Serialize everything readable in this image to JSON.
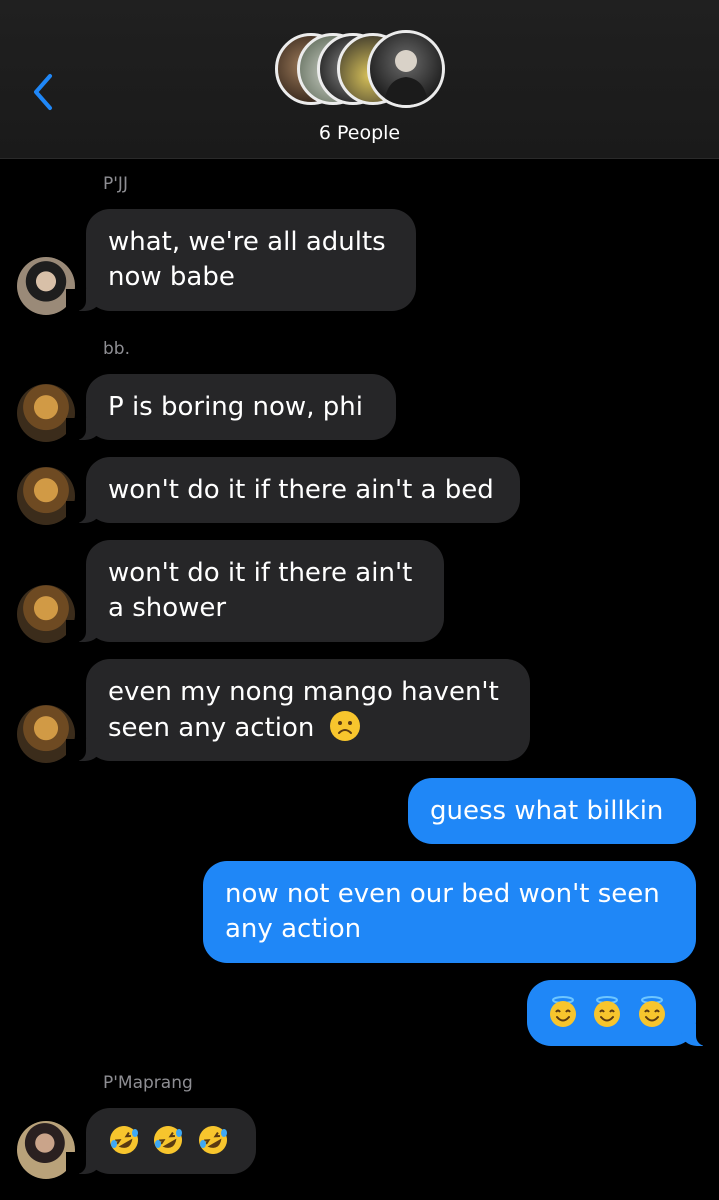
{
  "header": {
    "participants_label": "6 People"
  },
  "colors": {
    "background": "#000000",
    "header": "#1c1c1e",
    "incoming_bubble": "#262628",
    "outgoing_bubble": "#1f87f7",
    "accent": "#1f87f7",
    "sender_name": "#8e8e93"
  },
  "messages": [
    {
      "sender": "P'JJ",
      "lines": [
        "what, we're all adults",
        "now babe"
      ]
    },
    {
      "sender": "bb.",
      "lines": [
        "P is boring now, phi"
      ]
    },
    {
      "lines": [
        "won't do it if there ain't a bed"
      ]
    },
    {
      "lines": [
        "won't do it if there ain't",
        "a shower"
      ]
    },
    {
      "lines": [
        "even my nong mango haven't",
        "seen any action"
      ],
      "emoji": "frowning-face-icon"
    },
    {
      "outgoing": true,
      "lines": [
        "guess what billkin"
      ]
    },
    {
      "outgoing": true,
      "lines": [
        "now not even our bed won't seen",
        "any action"
      ]
    },
    {
      "outgoing": true,
      "emoji": [
        "smiling-face-with-halo-icon",
        "smiling-face-with-halo-icon",
        "smiling-face-with-halo-icon"
      ]
    },
    {
      "sender": "P'Maprang",
      "emoji": [
        "rolling-on-floor-laughing-icon",
        "rolling-on-floor-laughing-icon",
        "rolling-on-floor-laughing-icon"
      ]
    }
  ]
}
